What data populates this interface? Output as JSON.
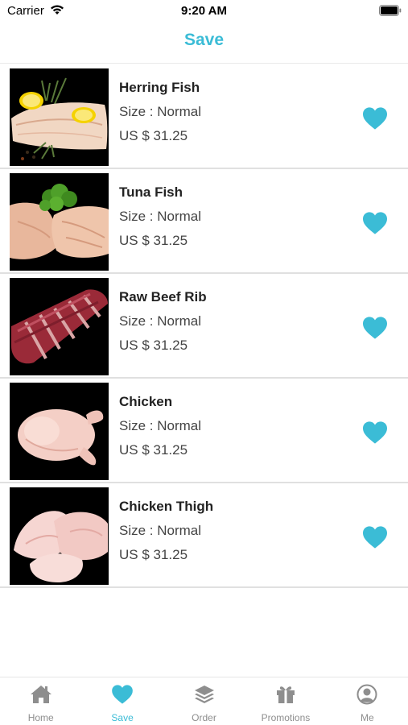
{
  "status_bar": {
    "carrier": "Carrier",
    "time": "9:20 AM"
  },
  "header": {
    "title": "Save"
  },
  "items": [
    {
      "name": "Herring Fish",
      "size": "Size : Normal",
      "price": "US $ 31.25"
    },
    {
      "name": "Tuna Fish",
      "size": "Size : Normal",
      "price": "US $ 31.25"
    },
    {
      "name": "Raw Beef Rib",
      "size": "Size : Normal",
      "price": "US $ 31.25"
    },
    {
      "name": "Chicken",
      "size": "Size : Normal",
      "price": "US $ 31.25"
    },
    {
      "name": "Chicken Thigh",
      "size": "Size : Normal",
      "price": "US $ 31.25"
    }
  ],
  "tabs": [
    {
      "label": "Home",
      "icon": "home-icon",
      "active": false
    },
    {
      "label": "Save",
      "icon": "heart-icon",
      "active": true
    },
    {
      "label": "Order",
      "icon": "layers-icon",
      "active": false
    },
    {
      "label": "Promotions",
      "icon": "gift-icon",
      "active": false
    },
    {
      "label": "Me",
      "icon": "user-icon",
      "active": false
    }
  ],
  "colors": {
    "accent": "#3bbcd6",
    "inactive": "#8e8e8e",
    "divider": "#e0e0e0"
  }
}
